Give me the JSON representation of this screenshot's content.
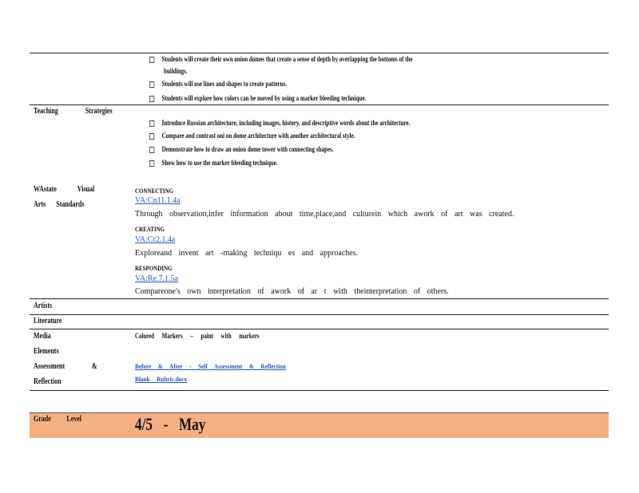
{
  "objectives": [
    "Students will create their own onion domes that create a sense of depth by overlapping the bottoms of the",
    "buildings.",
    "Students will use lines and shapes to create patterns.",
    "Students will explore how colors can be moved by using a marker bleeding technique."
  ],
  "teaching_strategies": {
    "label": "Teaching Strategies",
    "items": [
      "Introduce Russian architecture, including images, history, and descriptive words about the architecture.",
      "Compare and contrast oni on dome architecture with another architectural style.",
      "Demonstrate how to draw an onion dome tower with connecting shapes.",
      "Show how to use the marker bleeding technique."
    ]
  },
  "standards": {
    "label_line1": "WAstate Visual",
    "label_line2": "Arts Standards",
    "connecting_head": "CONNECTING",
    "connecting_code": "VA:Cn11.1.4a",
    "connecting_text": "Through observation,infer information about time,place,and culturein which awork of art was created.",
    "creating_head": "CREATING",
    "creating_code": "VA:Cr2.1.4a",
    "creating_text": "Exploreand invent art -making techniqu es and approaches.",
    "responding_head": "RESPONDING",
    "responding_code": "VA:Re.7.1.5a",
    "responding_text": "Compareone's own interpretation of awork of ar t with theinterpretation of others."
  },
  "rows": {
    "artists": "Artists",
    "literature": "Literature",
    "media": "Media",
    "media_value": "Colored Markers – paint with markers",
    "elements": "Elements",
    "assessment_line1": "Assessment",
    "assessment_amp": "&",
    "assessment_line2": "Reflection",
    "assessment_link1": "Before & After - Self Assessment & Reflection",
    "assessment_link2": "Blank Rubric.docx"
  },
  "grade": {
    "label": "Grade Level",
    "value": "4/5 - May"
  },
  "colors": {
    "grade_band": "#f5b082",
    "link": "#2a55b5"
  }
}
